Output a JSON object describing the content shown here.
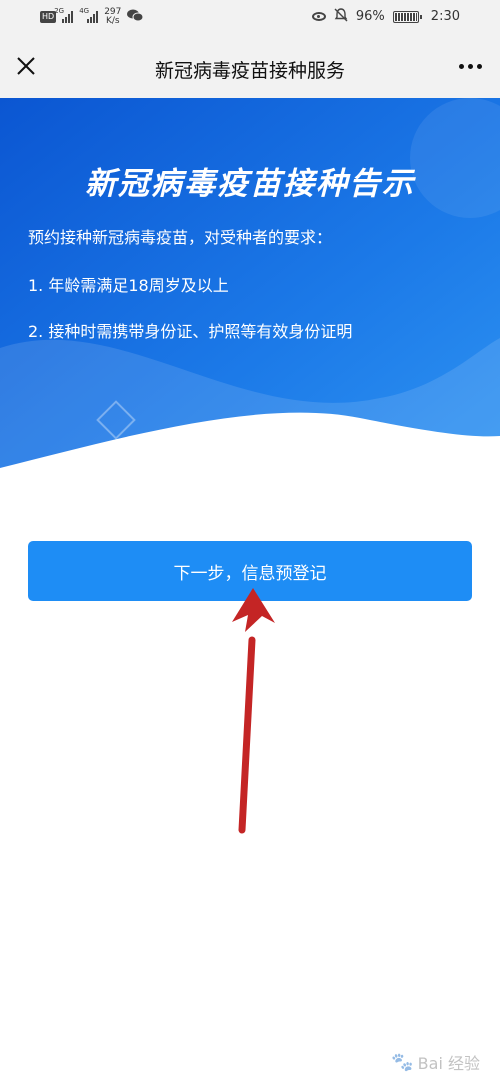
{
  "status_bar": {
    "hd_badge": "HD",
    "sig1_tag": "2G",
    "sig2_tag": "4G",
    "speed_value": "297",
    "speed_unit": "K/s",
    "battery_percent": "96%",
    "time": "2:30",
    "icons": [
      "wechat-icon",
      "eye-icon",
      "bell-off-icon",
      "battery-icon"
    ]
  },
  "title_bar": {
    "title": "新冠病毒疫苗接种服务",
    "icons": [
      "close-icon",
      "more-icon"
    ]
  },
  "banner": {
    "headline": "新冠病毒疫苗接种告示",
    "intro": "预约接种新冠病毒疫苗，对受种者的要求：",
    "requirements": [
      "1. 年龄需满足18周岁及以上",
      "2. 接种时需携带身份证、护照等有效身份证明"
    ]
  },
  "actions": {
    "next_step_label": "下一步，信息预登记"
  },
  "annotation": {
    "arrow_color": "#c42525"
  },
  "watermark": {
    "text": "Bai 经验"
  },
  "colors": {
    "banner_dark": "#0a5ad6",
    "banner_light": "#2b8ff0",
    "button_blue": "#1e8df5",
    "topbar_bg": "#f2f2f2"
  }
}
